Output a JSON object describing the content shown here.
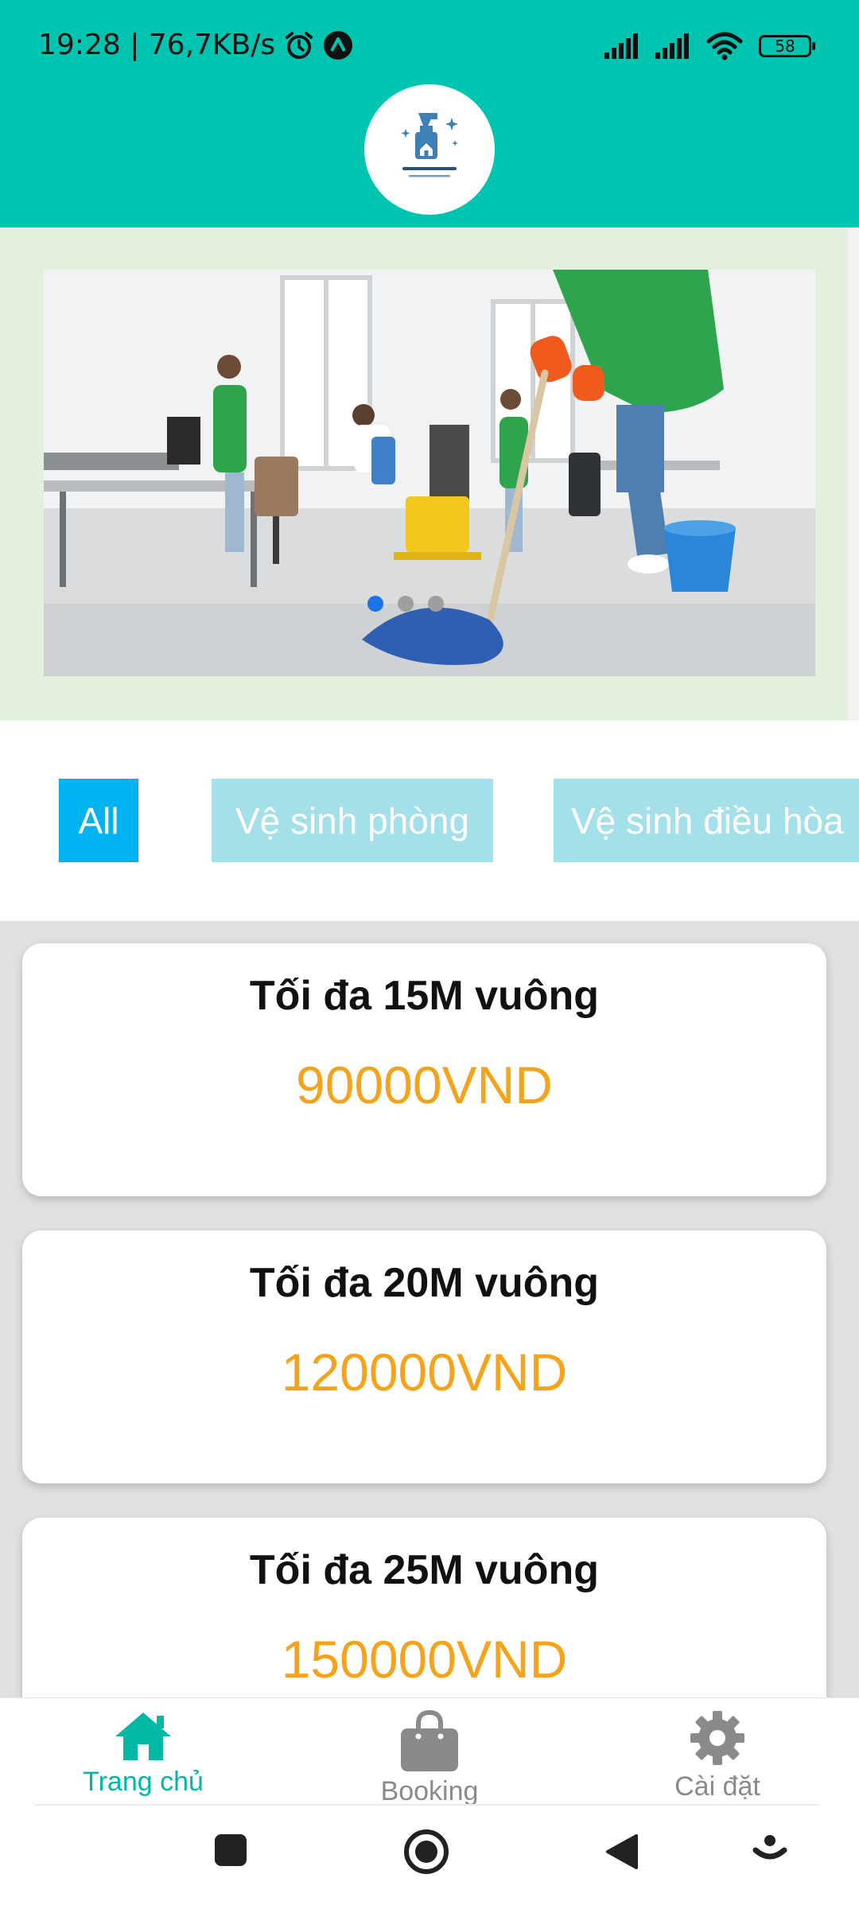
{
  "status_bar": {
    "time": "19:28",
    "separator": " | ",
    "speed": "76,7KB/s",
    "battery": "58",
    "icons": [
      "alarm-icon",
      "app-notification-icon",
      "signal-icon",
      "signal-icon",
      "wifi-icon",
      "battery-icon"
    ]
  },
  "header": {
    "logo_icon": "spray-bottle-house-logo",
    "colors": {
      "background": "#00c4b0"
    }
  },
  "banner": {
    "slide_count": 3,
    "active_slide": 1
  },
  "filters": {
    "items": [
      {
        "label": "All",
        "active": true
      },
      {
        "label": "Vệ sinh phòng",
        "active": false
      },
      {
        "label": "Vệ sinh điều hòa",
        "active": false
      }
    ],
    "colors": {
      "active": "#00b2f0",
      "inactive": "#a4e0ea"
    }
  },
  "cards": [
    {
      "title": "Tối đa 15M vuông",
      "price": "90000VND"
    },
    {
      "title": "Tối đa 20M vuông",
      "price": "120000VND"
    },
    {
      "title": "Tối đa 25M vuông",
      "price": "150000VND"
    }
  ],
  "bottom_nav": {
    "items": [
      {
        "label": "Trang chủ",
        "icon": "home-icon",
        "active": true
      },
      {
        "label": "Booking",
        "icon": "shopping-bag-icon",
        "active": false
      },
      {
        "label": "Cài đặt",
        "icon": "gear-icon",
        "active": false
      }
    ],
    "colors": {
      "active": "#00b8a4",
      "inactive": "#8a8a8a"
    }
  },
  "system_nav": {
    "icons": [
      "recents-square-icon",
      "home-circle-icon",
      "back-triangle-icon",
      "assistant-icon"
    ]
  },
  "colors": {
    "price": "#f5a31a",
    "banner_background": "#e3f1dc",
    "list_background": "#e0e0e0"
  }
}
